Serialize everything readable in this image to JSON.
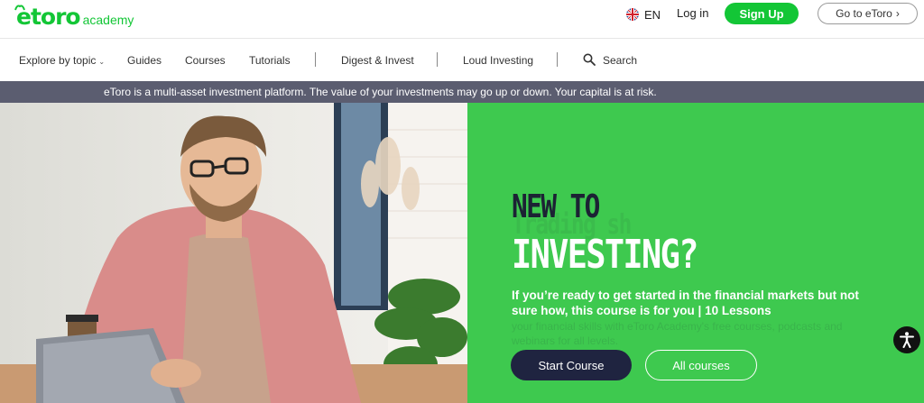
{
  "header": {
    "logo_text": "etoro",
    "logo_sub": "academy",
    "language": "EN",
    "login_label": "Log in",
    "signup_label": "Sign Up",
    "goto_label": "Go to eToro",
    "goto_chevron": "›"
  },
  "nav": {
    "items": [
      {
        "label": "Explore by topic",
        "chevron": "⌄"
      },
      {
        "label": "Guides"
      },
      {
        "label": "Courses"
      },
      {
        "label": "Tutorials"
      },
      {
        "label": "Digest & Invest"
      },
      {
        "label": "Loud Investing"
      }
    ],
    "search_label": "Search"
  },
  "risk_banner": "eToro is a multi-asset investment platform. The value of your investments may go up or down. Your capital is at risk.",
  "hero": {
    "headline_line1": "NEW TO",
    "headline_line2": "INVESTING?",
    "ghost_text": "Trading sh",
    "description": "If you’re ready to get started in the financial markets but not sure how, this course is for you | 10 Lessons",
    "ghost_description": "your financial skills with eToro Academy's free courses, podcasts and webinars for all levels.",
    "start_button": "Start Course",
    "all_button": "All courses"
  },
  "colors": {
    "brand_green": "#13c636",
    "hero_green": "#3ec94f",
    "banner_gray": "#5b5d70",
    "navy": "#1f2440"
  },
  "icons": [
    "uk-flag-icon",
    "search-icon",
    "accessibility-icon",
    "chevron-down-icon",
    "chevron-right-icon"
  ]
}
